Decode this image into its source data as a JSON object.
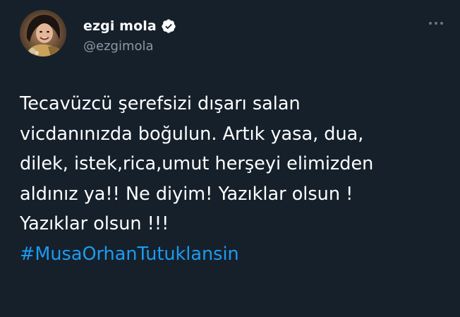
{
  "tweet": {
    "author": {
      "display_name": "ezgi mola",
      "handle": "@ezgimola",
      "verified": true,
      "avatar_icon": "profile-photo"
    },
    "more_icon": "more-horizontal-icon",
    "text_lines": [
      "Tecavüzcü şerefsizi dışarı salan",
      "vicdanınızda boğulun. Artık yasa, dua,",
      "dilek, istek,rica,umut herşeyi elimizden",
      "aldınız ya!! Ne diyim! Yazıklar olsun !",
      "Yazıklar olsun !!!"
    ],
    "hashtag": "#MusaOrhanTutuklansin"
  },
  "colors": {
    "background": "#15202b",
    "text": "#ffffff",
    "secondary_text": "#8b98a5",
    "link": "#1d9bf0"
  }
}
